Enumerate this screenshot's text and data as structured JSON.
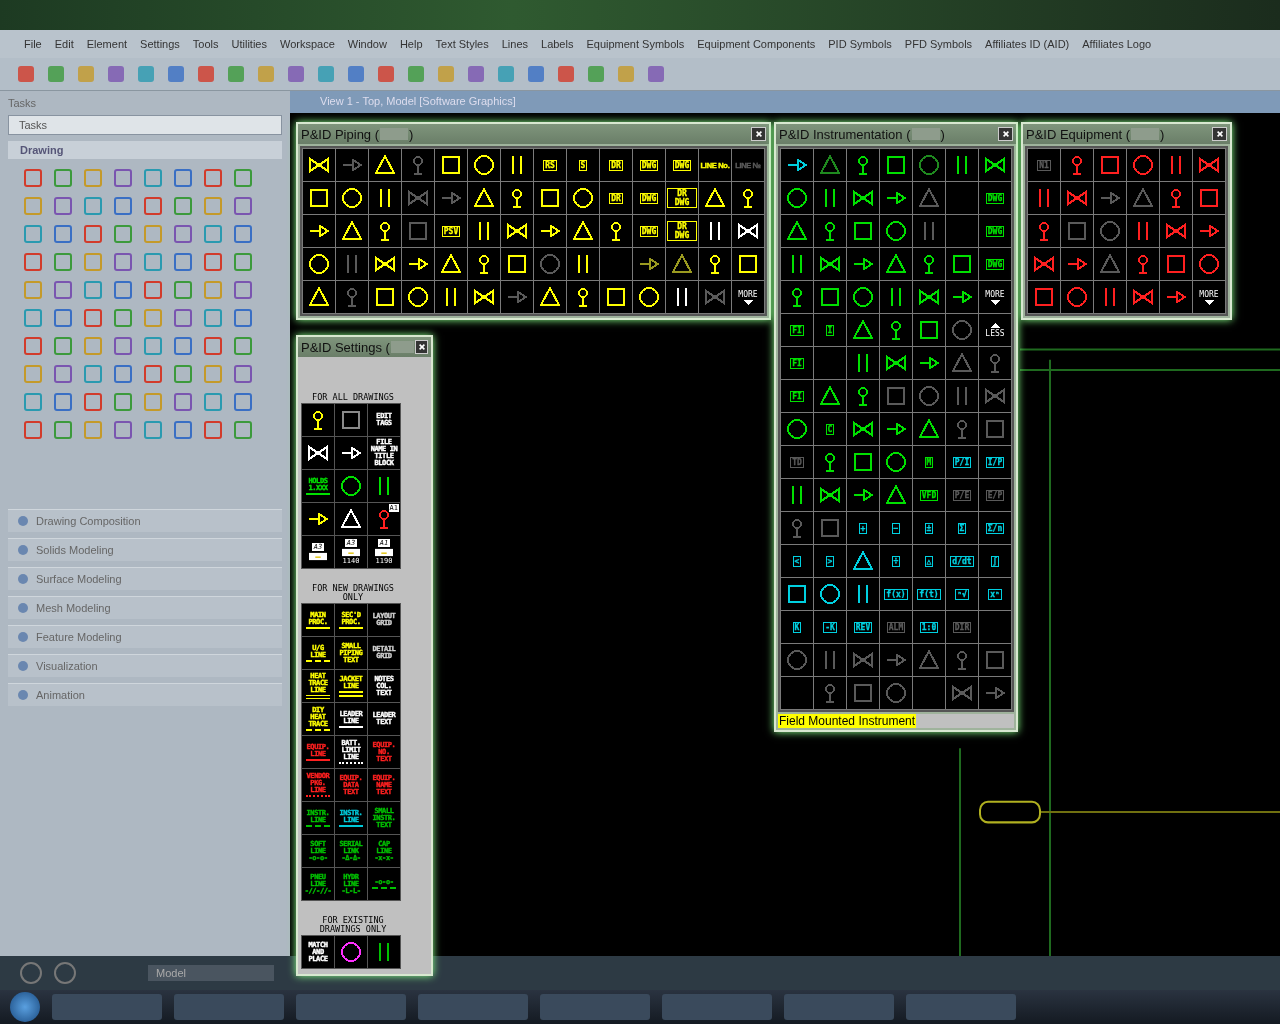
{
  "app": {
    "menu": [
      "File",
      "Edit",
      "Element",
      "Settings",
      "Tools",
      "Utilities",
      "Workspace",
      "Window",
      "Help",
      "Text Styles",
      "Lines",
      "Labels",
      "Equipment Symbols",
      "Equipment Components",
      "PID Symbols",
      "PFD Symbols",
      "Affiliates ID (AID)",
      "Affiliates Logo"
    ],
    "tasks_header": "Tasks",
    "tasks_dropdown": "Tasks",
    "drawing_section": "Drawing",
    "task_groups": [
      "Drawing Composition",
      "Solids Modeling",
      "Surface Modeling",
      "Mesh Modeling",
      "Feature Modeling",
      "Visualization",
      "Animation"
    ],
    "view_title": "View 1 - Top, Model [Software Graphics]",
    "model_dropdown": "Model"
  },
  "palettes": [
    {
      "kind": "grid",
      "title": "P&ID Piping (",
      "title_end": ")",
      "rows": [
        [
          {
            "kind": "icon",
            "color": "#ffff00"
          },
          {
            "kind": "icon",
            "color": "#5a5a5a"
          },
          {
            "kind": "icon",
            "color": "#ffff00"
          },
          {
            "kind": "icon",
            "color": "#5a5a5a"
          },
          {
            "kind": "icon",
            "color": "#ffff00"
          },
          {
            "kind": "icon",
            "color": "#ffff00"
          },
          {
            "kind": "icon",
            "color": "#ffff00"
          },
          {
            "kind": "boxed",
            "label": "RS",
            "color": "#ffff00"
          },
          {
            "kind": "boxed",
            "label": "S",
            "color": "#ffff00"
          },
          {
            "kind": "boxed",
            "label": "DR",
            "color": "#ffff00"
          },
          {
            "kind": "boxed",
            "label": "DWG",
            "color": "#ffff00"
          },
          {
            "kind": "boxed",
            "label": "DWG",
            "color": "#ffff00"
          },
          {
            "kind": "text",
            "label": "LINE No.",
            "color": "#ffff00"
          },
          {
            "kind": "text",
            "label": "LINE №",
            "color": "#5a5a5a"
          }
        ],
        [
          {
            "kind": "icon",
            "color": "#ffff00"
          },
          {
            "kind": "icon",
            "color": "#ffff00"
          },
          {
            "kind": "icon",
            "color": "#ffff00"
          },
          {
            "kind": "icon",
            "color": "#5a5a5a"
          },
          {
            "kind": "icon",
            "color": "#5a5a5a"
          },
          {
            "kind": "icon",
            "color": "#ffff00"
          },
          {
            "kind": "icon",
            "color": "#ffff00"
          },
          {
            "kind": "icon",
            "color": "#ffff00"
          },
          {
            "kind": "icon",
            "color": "#ffff00"
          },
          {
            "kind": "boxed",
            "label": "DR",
            "color": "#ffff00"
          },
          {
            "kind": "boxed",
            "label": "DWG",
            "color": "#ffff00"
          },
          {
            "kind": "boxed",
            "label": "DR DWG",
            "color": "#ffff00"
          },
          {
            "kind": "icon",
            "color": "#ffff00"
          },
          {
            "kind": "icon",
            "color": "#ffff00"
          }
        ],
        [
          {
            "kind": "icon",
            "color": "#ffff00"
          },
          {
            "kind": "icon",
            "color": "#ffff00"
          },
          {
            "kind": "icon",
            "color": "#ffff00"
          },
          {
            "kind": "icon",
            "color": "#5a5a5a"
          },
          {
            "kind": "boxed",
            "label": "PSV",
            "color": "#ffff00"
          },
          {
            "kind": "icon",
            "color": "#ffff00"
          },
          {
            "kind": "icon",
            "color": "#ffff00"
          },
          {
            "kind": "icon",
            "color": "#ffff00"
          },
          {
            "kind": "icon",
            "color": "#ffff00"
          },
          {
            "kind": "icon",
            "color": "#ffff00"
          },
          {
            "kind": "boxed",
            "label": "DWG",
            "color": "#ffff00"
          },
          {
            "kind": "boxed",
            "label": "DR DWG",
            "color": "#ffff00"
          },
          {
            "kind": "icon",
            "color": "#ffffff"
          },
          {
            "kind": "icon",
            "color": "#ffffff"
          }
        ],
        [
          {
            "kind": "icon",
            "color": "#ffff00"
          },
          {
            "kind": "icon",
            "color": "#5a5a5a"
          },
          {
            "kind": "icon",
            "color": "#ffff00"
          },
          {
            "kind": "icon",
            "color": "#ffff00"
          },
          {
            "kind": "icon",
            "color": "#ffff00"
          },
          {
            "kind": "icon",
            "color": "#ffff00"
          },
          {
            "kind": "icon",
            "color": "#ffff00"
          },
          {
            "kind": "icon",
            "color": "#5a5a5a"
          },
          {
            "kind": "icon",
            "color": "#ffff00"
          },
          {
            "kind": "empty"
          },
          {
            "kind": "icon",
            "color": "#9a9a20"
          },
          {
            "kind": "icon",
            "color": "#9a9a20"
          },
          {
            "kind": "icon",
            "color": "#ffff00"
          },
          {
            "kind": "icon",
            "color": "#ffff00"
          }
        ],
        [
          {
            "kind": "icon",
            "color": "#ffff00"
          },
          {
            "kind": "icon",
            "color": "#5a5a5a"
          },
          {
            "kind": "icon",
            "color": "#ffff00"
          },
          {
            "kind": "icon",
            "color": "#ffff00"
          },
          {
            "kind": "icon",
            "color": "#ffff00"
          },
          {
            "kind": "icon",
            "color": "#ffff00"
          },
          {
            "kind": "icon",
            "color": "#5a5a5a"
          },
          {
            "kind": "icon",
            "color": "#ffff00"
          },
          {
            "kind": "icon",
            "color": "#ffff00"
          },
          {
            "kind": "icon",
            "color": "#ffff00"
          },
          {
            "kind": "icon",
            "color": "#ffff00"
          },
          {
            "kind": "icon",
            "color": "#ffffff"
          },
          {
            "kind": "icon",
            "color": "#5a5a5a"
          },
          {
            "kind": "more",
            "label": "MORE",
            "color": "#ffffff"
          }
        ]
      ]
    },
    {
      "kind": "tall",
      "title": "P&ID Instrumentation (",
      "title_end": ")",
      "rows": [
        [
          {
            "kind": "icon",
            "color": "#00d0e0"
          },
          {
            "kind": "icon",
            "color": "#1f8a1f"
          },
          {
            "kind": "icon",
            "color": "#00e000"
          },
          {
            "kind": "icon",
            "color": "#00e000"
          },
          {
            "kind": "icon",
            "color": "#1f8a1f"
          },
          {
            "kind": "icon",
            "color": "#00e000"
          },
          {
            "kind": "icon",
            "color": "#00e000"
          }
        ],
        [
          {
            "kind": "icon",
            "color": "#00e000"
          },
          {
            "kind": "icon",
            "color": "#00e000"
          },
          {
            "kind": "icon",
            "color": "#00e000"
          },
          {
            "kind": "icon",
            "color": "#00e000"
          },
          {
            "kind": "icon",
            "color": "#5a5a5a"
          },
          {
            "kind": "empty"
          },
          {
            "kind": "boxed",
            "label": "DWG",
            "color": "#00e000"
          }
        ],
        [
          {
            "kind": "icon",
            "color": "#00e000"
          },
          {
            "kind": "icon",
            "color": "#00e000"
          },
          {
            "kind": "icon",
            "color": "#00e000"
          },
          {
            "kind": "icon",
            "color": "#00e000"
          },
          {
            "kind": "icon",
            "color": "#5a5a5a"
          },
          {
            "kind": "empty"
          },
          {
            "kind": "boxed",
            "label": "DWG",
            "color": "#00e000"
          }
        ],
        [
          {
            "kind": "icon",
            "color": "#00e000"
          },
          {
            "kind": "icon",
            "color": "#00e000"
          },
          {
            "kind": "icon",
            "color": "#00e000"
          },
          {
            "kind": "icon",
            "color": "#00e000"
          },
          {
            "kind": "icon",
            "color": "#00e000"
          },
          {
            "kind": "icon",
            "color": "#00e000"
          },
          {
            "kind": "boxed",
            "label": "DWG",
            "color": "#00e000"
          }
        ],
        [
          {
            "kind": "icon",
            "color": "#00e000"
          },
          {
            "kind": "icon",
            "color": "#00e000"
          },
          {
            "kind": "icon",
            "color": "#00e000"
          },
          {
            "kind": "icon",
            "color": "#00e000"
          },
          {
            "kind": "icon",
            "color": "#00e000"
          },
          {
            "kind": "icon",
            "color": "#00e000"
          },
          {
            "kind": "more",
            "label": "MORE",
            "color": "#ffffff"
          }
        ],
        [
          {
            "kind": "boxed",
            "label": "FI",
            "color": "#00e000"
          },
          {
            "kind": "boxed",
            "label": "I",
            "color": "#00e000"
          },
          {
            "kind": "icon",
            "color": "#00e000"
          },
          {
            "kind": "icon",
            "color": "#00e000"
          },
          {
            "kind": "icon",
            "color": "#00e000"
          },
          {
            "kind": "icon",
            "color": "#5a5a5a"
          },
          {
            "kind": "less",
            "label": "LESS",
            "color": "#ffffff"
          }
        ],
        [
          {
            "kind": "boxed",
            "label": "FI",
            "color": "#00e000"
          },
          {
            "kind": "empty"
          },
          {
            "kind": "icon",
            "color": "#00e000"
          },
          {
            "kind": "icon",
            "color": "#00e000"
          },
          {
            "kind": "icon",
            "color": "#00e000"
          },
          {
            "kind": "icon",
            "color": "#5a5a5a"
          },
          {
            "kind": "icon",
            "color": "#5a5a5a"
          }
        ],
        [
          {
            "kind": "boxed",
            "label": "FI",
            "color": "#00e000"
          },
          {
            "kind": "icon",
            "color": "#00e000"
          },
          {
            "kind": "icon",
            "color": "#00e000"
          },
          {
            "kind": "icon",
            "color": "#5a5a5a"
          },
          {
            "kind": "icon",
            "color": "#5a5a5a"
          },
          {
            "kind": "icon",
            "color": "#5a5a5a"
          },
          {
            "kind": "icon",
            "color": "#5a5a5a"
          }
        ],
        [
          {
            "kind": "icon",
            "color": "#00e000"
          },
          {
            "kind": "boxed",
            "label": "C",
            "color": "#00e000"
          },
          {
            "kind": "icon",
            "color": "#00e000"
          },
          {
            "kind": "icon",
            "color": "#00e000"
          },
          {
            "kind": "icon",
            "color": "#00e000"
          },
          {
            "kind": "icon",
            "color": "#5a5a5a"
          },
          {
            "kind": "icon",
            "color": "#5a5a5a"
          }
        ],
        [
          {
            "kind": "boxed",
            "label": "TD",
            "color": "#5a5a5a"
          },
          {
            "kind": "icon",
            "color": "#00e000"
          },
          {
            "kind": "icon",
            "color": "#00e000"
          },
          {
            "kind": "icon",
            "color": "#00e000"
          },
          {
            "kind": "boxed",
            "label": "M",
            "color": "#00e000"
          },
          {
            "kind": "boxed",
            "label": "P/I",
            "color": "#00d0e0"
          },
          {
            "kind": "boxed",
            "label": "I/P",
            "color": "#00d0e0"
          }
        ],
        [
          {
            "kind": "icon",
            "color": "#00e000"
          },
          {
            "kind": "icon",
            "color": "#00e000"
          },
          {
            "kind": "icon",
            "color": "#00e000"
          },
          {
            "kind": "icon",
            "color": "#00e000"
          },
          {
            "kind": "boxed",
            "label": "VFD",
            "color": "#00e000"
          },
          {
            "kind": "boxed",
            "label": "P/E",
            "color": "#5a5a5a"
          },
          {
            "kind": "boxed",
            "label": "E/P",
            "color": "#5a5a5a"
          }
        ],
        [
          {
            "kind": "icon",
            "color": "#5a5a5a"
          },
          {
            "kind": "icon",
            "color": "#5a5a5a"
          },
          {
            "kind": "boxed",
            "label": "+",
            "color": "#00d0e0"
          },
          {
            "kind": "boxed",
            "label": "−",
            "color": "#00d0e0"
          },
          {
            "kind": "boxed",
            "label": "±",
            "color": "#00d0e0"
          },
          {
            "kind": "boxed",
            "label": "Σ",
            "color": "#00d0e0"
          },
          {
            "kind": "boxed",
            "label": "Σ/n",
            "color": "#00d0e0"
          }
        ],
        [
          {
            "kind": "boxed",
            "label": "<",
            "color": "#00d0e0"
          },
          {
            "kind": "boxed",
            "label": ">",
            "color": "#00d0e0"
          },
          {
            "kind": "icon",
            "color": "#00d0e0"
          },
          {
            "kind": "boxed",
            "label": "÷",
            "color": "#00d0e0"
          },
          {
            "kind": "boxed",
            "label": "△",
            "color": "#00d0e0"
          },
          {
            "kind": "boxed",
            "label": "d/dt",
            "color": "#00d0e0"
          },
          {
            "kind": "boxed",
            "label": "∫",
            "color": "#00d0e0"
          }
        ],
        [
          {
            "kind": "icon",
            "color": "#00d0e0"
          },
          {
            "kind": "icon",
            "color": "#00d0e0"
          },
          {
            "kind": "icon",
            "color": "#00d0e0"
          },
          {
            "kind": "boxed",
            "label": "f(x)",
            "color": "#00d0e0"
          },
          {
            "kind": "boxed",
            "label": "f(t)",
            "color": "#00d0e0"
          },
          {
            "kind": "boxed",
            "label": "ⁿ√",
            "color": "#00d0e0"
          },
          {
            "kind": "boxed",
            "label": "xⁿ",
            "color": "#00d0e0"
          }
        ],
        [
          {
            "kind": "boxed",
            "label": "K",
            "color": "#00d0e0"
          },
          {
            "kind": "boxed",
            "label": "-K",
            "color": "#00d0e0"
          },
          {
            "kind": "boxed",
            "label": "REV",
            "color": "#00d0e0"
          },
          {
            "kind": "boxed",
            "label": "ALM",
            "color": "#5a5a5a"
          },
          {
            "kind": "boxed",
            "label": "1:0",
            "color": "#00d0e0"
          },
          {
            "kind": "boxed",
            "label": "DIR",
            "color": "#5a5a5a"
          },
          {
            "kind": "empty"
          }
        ],
        [
          {
            "kind": "icon",
            "color": "#5a5a5a"
          },
          {
            "kind": "icon",
            "color": "#5a5a5a"
          },
          {
            "kind": "icon",
            "color": "#5a5a5a"
          },
          {
            "kind": "icon",
            "color": "#5a5a5a"
          },
          {
            "kind": "icon",
            "color": "#5a5a5a"
          },
          {
            "kind": "icon",
            "color": "#5a5a5a"
          },
          {
            "kind": "icon",
            "color": "#5a5a5a"
          }
        ],
        [
          {
            "kind": "empty"
          },
          {
            "kind": "icon",
            "color": "#5a5a5a"
          },
          {
            "kind": "icon",
            "color": "#5a5a5a"
          },
          {
            "kind": "icon",
            "color": "#5a5a5a"
          },
          {
            "kind": "empty"
          },
          {
            "kind": "icon",
            "color": "#5a5a5a"
          },
          {
            "kind": "icon",
            "color": "#5a5a5a"
          }
        ]
      ],
      "status": "Field Mounted Instrument"
    },
    {
      "kind": "small",
      "title": "P&ID Equipment (",
      "title_end": ")",
      "rows": [
        [
          {
            "kind": "boxed",
            "label": "N1",
            "color": "#5a5a5a"
          },
          {
            "kind": "icon",
            "color": "#ff2020"
          },
          {
            "kind": "icon",
            "color": "#ff2020"
          },
          {
            "kind": "icon",
            "color": "#ff2020"
          },
          {
            "kind": "icon",
            "color": "#ff2020"
          },
          {
            "kind": "icon",
            "color": "#ff2020"
          }
        ],
        [
          {
            "kind": "icon",
            "color": "#ff2020"
          },
          {
            "kind": "icon",
            "color": "#ff2020"
          },
          {
            "kind": "icon",
            "color": "#5a5a5a"
          },
          {
            "kind": "icon",
            "color": "#5a5a5a"
          },
          {
            "kind": "icon",
            "color": "#ff2020"
          },
          {
            "kind": "icon",
            "color": "#ff2020"
          }
        ],
        [
          {
            "kind": "icon",
            "color": "#ff2020"
          },
          {
            "kind": "icon",
            "color": "#5a5a5a"
          },
          {
            "kind": "icon",
            "color": "#5a5a5a"
          },
          {
            "kind": "icon",
            "color": "#ff2020"
          },
          {
            "kind": "icon",
            "color": "#ff2020"
          },
          {
            "kind": "icon",
            "color": "#ff2020"
          }
        ],
        [
          {
            "kind": "icon",
            "color": "#ff2020"
          },
          {
            "kind": "icon",
            "color": "#ff2020"
          },
          {
            "kind": "icon",
            "color": "#5a5a5a"
          },
          {
            "kind": "icon",
            "color": "#ff2020"
          },
          {
            "kind": "icon",
            "color": "#ff2020"
          },
          {
            "kind": "icon",
            "color": "#ff2020"
          }
        ],
        [
          {
            "kind": "icon",
            "color": "#ff2020"
          },
          {
            "kind": "icon",
            "color": "#ff2020"
          },
          {
            "kind": "icon",
            "color": "#ff2020"
          },
          {
            "kind": "icon",
            "color": "#ff2020"
          },
          {
            "kind": "icon",
            "color": "#ff2020"
          },
          {
            "kind": "more",
            "label": "MORE",
            "color": "#ffffff"
          }
        ]
      ]
    },
    {
      "kind": "settings",
      "title": "P&ID Settings (",
      "sections": [
        {
          "heading": "FOR ALL DRAWINGS",
          "rows": [
            [
              {
                "kind": "icon",
                "color": "#ffff00"
              },
              {
                "kind": "icon",
                "color": "#8a8a8a"
              },
              {
                "kind": "text",
                "lines": [
                  "EDIT",
                  "TAGS"
                ],
                "color": "#ffffff"
              }
            ],
            [
              {
                "kind": "icon",
                "color": "#ffffff"
              },
              {
                "kind": "icon",
                "color": "#ffffff"
              },
              {
                "kind": "text",
                "lines": [
                  "FILE",
                  "NAME IN",
                  "TITLE",
                  "BLOCK"
                ],
                "color": "#ffffff"
              }
            ],
            [
              {
                "kind": "text",
                "lines": [
                  "HOLDS",
                  "1.XXX"
                ],
                "color": "#00e000",
                "rule": {
                  "kind": "solid"
                }
              },
              {
                "kind": "icon",
                "color": "#00e000"
              },
              {
                "kind": "icon",
                "color": "#00e000"
              }
            ],
            [
              {
                "kind": "icon",
                "color": "#ffff00"
              },
              {
                "kind": "icon",
                "color": "#ffffff"
              },
              {
                "kind": "icon",
                "color": "#ff2020",
                "badge": "A1"
              }
            ],
            [
              {
                "kind": "printer",
                "label": "A3",
                "color": "#ffffff"
              },
              {
                "kind": "printer",
                "label": "A3",
                "caption": "1140",
                "color": "#ffffff"
              },
              {
                "kind": "printer",
                "label": "A1",
                "caption": "1190",
                "color": "#ffffff"
              }
            ]
          ]
        },
        {
          "heading": "FOR NEW DRAWINGS ONLY",
          "rows": [
            [
              {
                "kind": "text",
                "lines": [
                  "MAIN",
                  "PROC."
                ],
                "color": "#ffff00",
                "rule": {
                  "kind": "solid"
                }
              },
              {
                "kind": "text",
                "lines": [
                  "SEC'D",
                  "PROC."
                ],
                "color": "#ffff00",
                "rule": {
                  "kind": "solid"
                }
              },
              {
                "kind": "text",
                "lines": [
                  "LAYOUT",
                  "GRID"
                ],
                "color": "#d0d0d0"
              }
            ],
            [
              {
                "kind": "text",
                "lines": [
                  "U/G",
                  "LINE"
                ],
                "color": "#ffff00",
                "rule": {
                  "kind": "dashed"
                }
              },
              {
                "kind": "text",
                "lines": [
                  "SMALL",
                  "PIPING",
                  "TEXT"
                ],
                "color": "#ffff00"
              },
              {
                "kind": "text",
                "lines": [
                  "DETAIL",
                  "GRID"
                ],
                "color": "#d0d0d0"
              }
            ],
            [
              {
                "kind": "text",
                "lines": [
                  "HEAT",
                  "TRACE",
                  "LINE"
                ],
                "color": "#ffff00",
                "rule": {
                  "kind": "double"
                }
              },
              {
                "kind": "text",
                "lines": [
                  "JACKET",
                  "LINE"
                ],
                "color": "#ffff00",
                "rule": {
                  "kind": "triple"
                }
              },
              {
                "kind": "text",
                "lines": [
                  "NOTES",
                  "COL.",
                  "TEXT"
                ],
                "color": "#ffffff"
              }
            ],
            [
              {
                "kind": "text",
                "lines": [
                  "DIY",
                  "HEAT",
                  "TRACE"
                ],
                "color": "#ffff00",
                "rule": {
                  "kind": "dashed"
                }
              },
              {
                "kind": "text",
                "lines": [
                  "LEADER",
                  "LINE"
                ],
                "color": "#ffffff",
                "rule": {
                  "kind": "solid"
                }
              },
              {
                "kind": "text",
                "lines": [
                  "LEADER",
                  "TEXT"
                ],
                "color": "#ffffff"
              }
            ],
            [
              {
                "kind": "text",
                "lines": [
                  "EQUIP.",
                  "LINE"
                ],
                "color": "#ff2020",
                "rule": {
                  "kind": "solid"
                }
              },
              {
                "kind": "text",
                "lines": [
                  "BATT.",
                  "LIMIT",
                  "LINE"
                ],
                "color": "#ffffff",
                "rule": {
                  "kind": "dashdot"
                }
              },
              {
                "kind": "text",
                "lines": [
                  "EQUIP.",
                  "NO.",
                  "TEXT"
                ],
                "color": "#ff2020"
              }
            ],
            [
              {
                "kind": "text",
                "lines": [
                  "VENDOR",
                  "PKG.",
                  "LINE"
                ],
                "color": "#ff2020",
                "rule": {
                  "kind": "dashdot"
                }
              },
              {
                "kind": "text",
                "lines": [
                  "EQUIP.",
                  "DATA",
                  "TEXT"
                ],
                "color": "#ff2020"
              },
              {
                "kind": "text",
                "lines": [
                  "EQUIP.",
                  "NAME",
                  "TEXT"
                ],
                "color": "#ff2020"
              }
            ],
            [
              {
                "kind": "text",
                "lines": [
                  "INSTR.",
                  "LINE"
                ],
                "color": "#00c000",
                "rule": {
                  "kind": "dashed"
                }
              },
              {
                "kind": "text",
                "lines": [
                  "INSTR.",
                  "LINE"
                ],
                "color": "#00c8d8",
                "rule": {
                  "kind": "solid"
                }
              },
              {
                "kind": "text",
                "lines": [
                  "SMALL",
                  "INSTR.",
                  "TEXT"
                ],
                "color": "#00c000"
              }
            ],
            [
              {
                "kind": "text",
                "lines": [
                  "SOFT",
                  "LINE",
                  "-o-o-"
                ],
                "color": "#00c000"
              },
              {
                "kind": "text",
                "lines": [
                  "SERIAL",
                  "LINK",
                  "-Δ-Δ-"
                ],
                "color": "#00c000"
              },
              {
                "kind": "text",
                "lines": [
                  "CAP",
                  "LINE",
                  "-x-x-"
                ],
                "color": "#00c000"
              }
            ],
            [
              {
                "kind": "text",
                "lines": [
                  "PNEU",
                  "LINE",
                  "-//-//-"
                ],
                "color": "#00c000"
              },
              {
                "kind": "text",
                "lines": [
                  "HYDR",
                  "LINE",
                  "-L-L-"
                ],
                "color": "#00c000"
              },
              {
                "kind": "text",
                "lines": [
                  "-o-o-"
                ],
                "color": "#00c000",
                "rule": {
                  "kind": "dashed"
                }
              }
            ]
          ]
        },
        {
          "heading": "FOR EXISTING DRAWINGS ONLY",
          "rows": [
            [
              {
                "kind": "text",
                "lines": [
                  "MATCH",
                  "AND",
                  "PLACE"
                ],
                "color": "#ffffff"
              },
              {
                "kind": "icon",
                "color": "#ff30ff"
              },
              {
                "kind": "icon",
                "color": "#00c000"
              }
            ]
          ]
        }
      ]
    }
  ]
}
